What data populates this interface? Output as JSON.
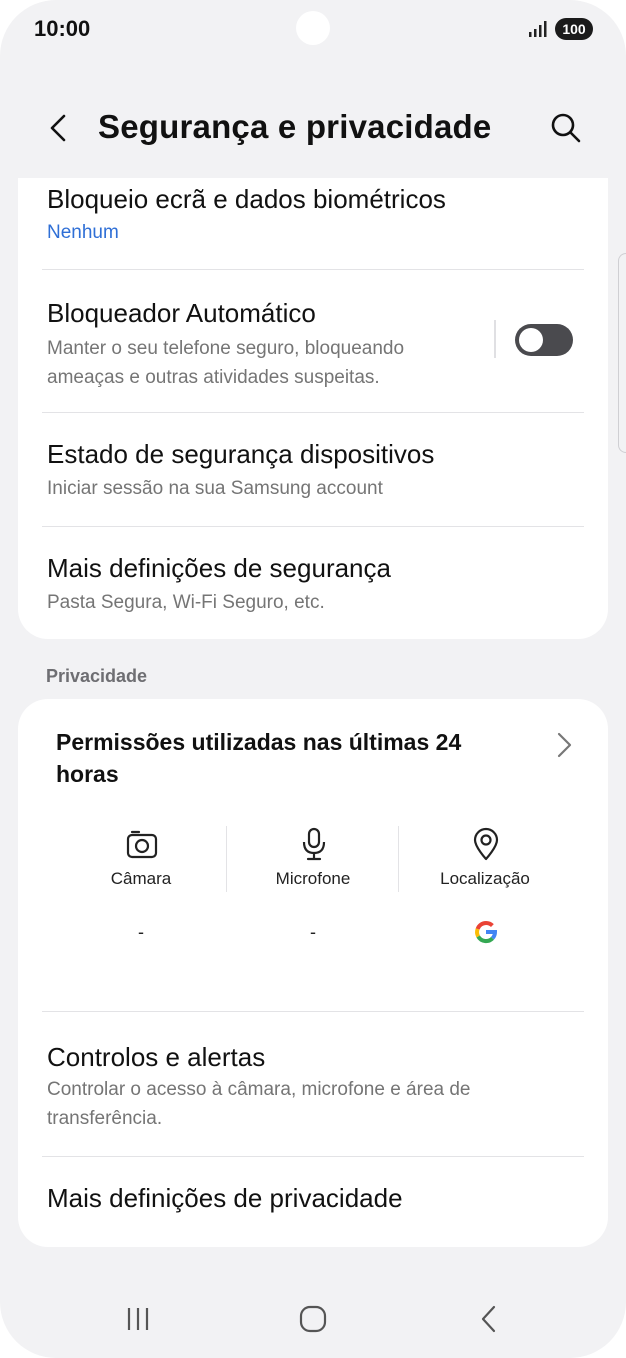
{
  "status_bar": {
    "time": "10:00",
    "battery": "100",
    "icons": [
      "signal-icon",
      "battery-icon"
    ]
  },
  "app_bar": {
    "title": "Segurança e privacidade",
    "icons": [
      "back-arrow-icon",
      "search-icon"
    ]
  },
  "security": {
    "items": [
      {
        "title": "Bloqueio ecrã e dados biométricos",
        "subtitle": "Nenhum"
      },
      {
        "title": "Bloqueador Automático",
        "subtitle_line1": "Manter o seu telefone seguro, bloqueando",
        "subtitle_line2": "ameaças e outras atividades suspeitas.",
        "toggle_on": false
      },
      {
        "title": "Estado de segurança dispositivos",
        "subtitle": "Iniciar sessão na sua Samsung account"
      },
      {
        "title": "Mais definições de segurança",
        "subtitle": "Pasta Segura, Wi-Fi Seguro, etc."
      }
    ]
  },
  "privacy": {
    "header": "Privacidade",
    "permissions": {
      "title_line1": "Permissões utilizadas nas últimas 24",
      "title_line2": "horas",
      "columns": [
        {
          "label": "Câmara",
          "value": "-",
          "icon": "camera-icon"
        },
        {
          "label": "Microfone",
          "value": "-",
          "icon": "microphone-icon"
        },
        {
          "label": "Localização",
          "value": "",
          "icon": "location-icon",
          "app_icon": "google-logo-icon"
        }
      ]
    },
    "items": [
      {
        "title": "Controlos e alertas",
        "subtitle_line1": "Controlar o acesso à câmara, microfone e área de",
        "subtitle_line2": "transferência."
      },
      {
        "title": "Mais definições de privacidade"
      }
    ]
  },
  "nav_bar": {
    "icons": [
      "recent-apps-icon",
      "home-icon",
      "back-icon"
    ]
  },
  "colors": {
    "background": "#f2f2f4",
    "card": "#ffffff",
    "accent_blue": "#2f6fd6",
    "toggle_off": "#4a4a4e"
  }
}
